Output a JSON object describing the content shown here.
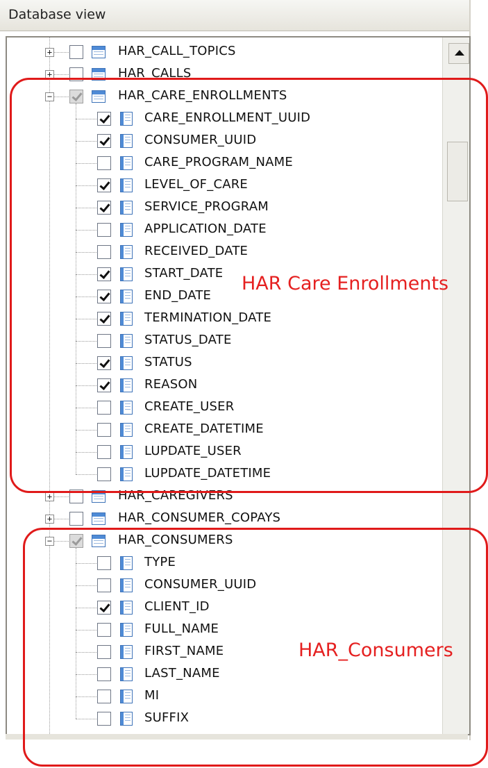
{
  "panel": {
    "title": "Database view"
  },
  "tree": {
    "rows": [
      {
        "label": "HAR_CALL_TOPICS",
        "type": "table",
        "expander": "+",
        "checked": false
      },
      {
        "label": "HAR_CALLS",
        "type": "table",
        "expander": "+",
        "checked": false
      },
      {
        "label": "HAR_CARE_ENROLLMENTS",
        "type": "table",
        "expander": "−",
        "checked": "partial"
      },
      {
        "label": "CARE_ENROLLMENT_UUID",
        "type": "column",
        "checked": true
      },
      {
        "label": "CONSUMER_UUID",
        "type": "column",
        "checked": true
      },
      {
        "label": "CARE_PROGRAM_NAME",
        "type": "column",
        "checked": false
      },
      {
        "label": "LEVEL_OF_CARE",
        "type": "column",
        "checked": true
      },
      {
        "label": "SERVICE_PROGRAM",
        "type": "column",
        "checked": true
      },
      {
        "label": "APPLICATION_DATE",
        "type": "column",
        "checked": false
      },
      {
        "label": "RECEIVED_DATE",
        "type": "column",
        "checked": false
      },
      {
        "label": "START_DATE",
        "type": "column",
        "checked": true
      },
      {
        "label": "END_DATE",
        "type": "column",
        "checked": true
      },
      {
        "label": "TERMINATION_DATE",
        "type": "column",
        "checked": true
      },
      {
        "label": "STATUS_DATE",
        "type": "column",
        "checked": false
      },
      {
        "label": "STATUS",
        "type": "column",
        "checked": true
      },
      {
        "label": "REASON",
        "type": "column",
        "checked": true
      },
      {
        "label": "CREATE_USER",
        "type": "column",
        "checked": false
      },
      {
        "label": "CREATE_DATETIME",
        "type": "column",
        "checked": false
      },
      {
        "label": "LUPDATE_USER",
        "type": "column",
        "checked": false
      },
      {
        "label": "LUPDATE_DATETIME",
        "type": "column",
        "checked": false
      },
      {
        "label": "HAR_CAREGIVERS",
        "type": "table",
        "expander": "+",
        "checked": false
      },
      {
        "label": "HAR_CONSUMER_COPAYS",
        "type": "table",
        "expander": "+",
        "checked": false
      },
      {
        "label": "HAR_CONSUMERS",
        "type": "table",
        "expander": "−",
        "checked": "partial"
      },
      {
        "label": "TYPE",
        "type": "column",
        "checked": false
      },
      {
        "label": "CONSUMER_UUID",
        "type": "column",
        "checked": false
      },
      {
        "label": "CLIENT_ID",
        "type": "column",
        "checked": true
      },
      {
        "label": "FULL_NAME",
        "type": "column",
        "checked": false
      },
      {
        "label": "FIRST_NAME",
        "type": "column",
        "checked": false
      },
      {
        "label": "LAST_NAME",
        "type": "column",
        "checked": false
      },
      {
        "label": "MI",
        "type": "column",
        "checked": false
      },
      {
        "label": "SUFFIX",
        "type": "column",
        "checked": false
      }
    ]
  },
  "annotations": {
    "care_enrollments": "HAR Care Enrollments",
    "consumers": "HAR_Consumers",
    "color": "#e01a1a"
  }
}
